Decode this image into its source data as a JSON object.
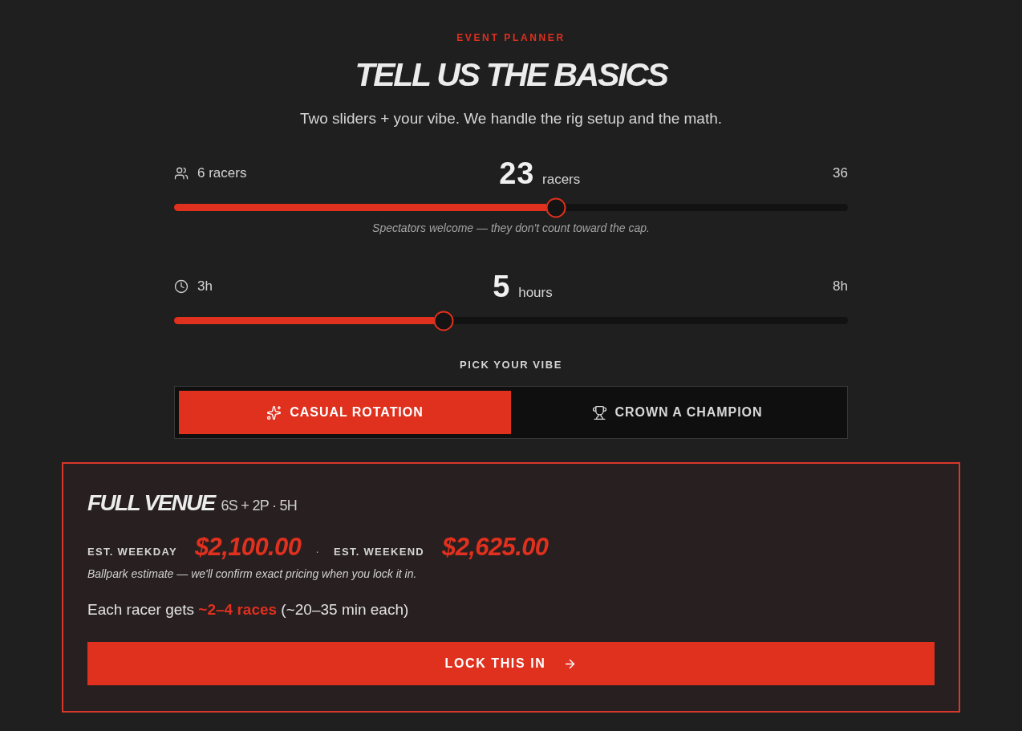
{
  "header": {
    "eyebrow": "EVENT PLANNER",
    "title": "TELL US THE BASICS",
    "subtitle": "Two sliders + your vibe. We handle the rig setup and the math."
  },
  "sliders": [
    {
      "min_label": "6 racers",
      "value": "23",
      "unit": "racers",
      "max_label": "36",
      "level": 0.567,
      "note": "Spectators welcome — they don't count toward the cap."
    },
    {
      "min_label": "3h",
      "value": "5",
      "unit": "hours",
      "max_label": "8h",
      "level": 0.4
    }
  ],
  "vibe": {
    "label": "PICK YOUR VIBE",
    "options": [
      {
        "label": "CASUAL ROTATION",
        "selected": true
      },
      {
        "label": "CROWN A CHAMPION",
        "selected": false
      }
    ]
  },
  "estimate": {
    "title": "FULL VENUE",
    "config": "6S + 2P · 5H",
    "prices": [
      {
        "label": "EST. WEEKDAY",
        "amount": "$2,100.00"
      },
      {
        "label": "EST. WEEKEND",
        "amount": "$2,625.00"
      }
    ],
    "separator": "·",
    "disclaimer": "Ballpark estimate — we'll confirm exact pricing when you lock it in.",
    "races_line": "Each racer gets **~2–4 races** (~20–35 min each)",
    "cta": "LOCK THIS IN"
  }
}
